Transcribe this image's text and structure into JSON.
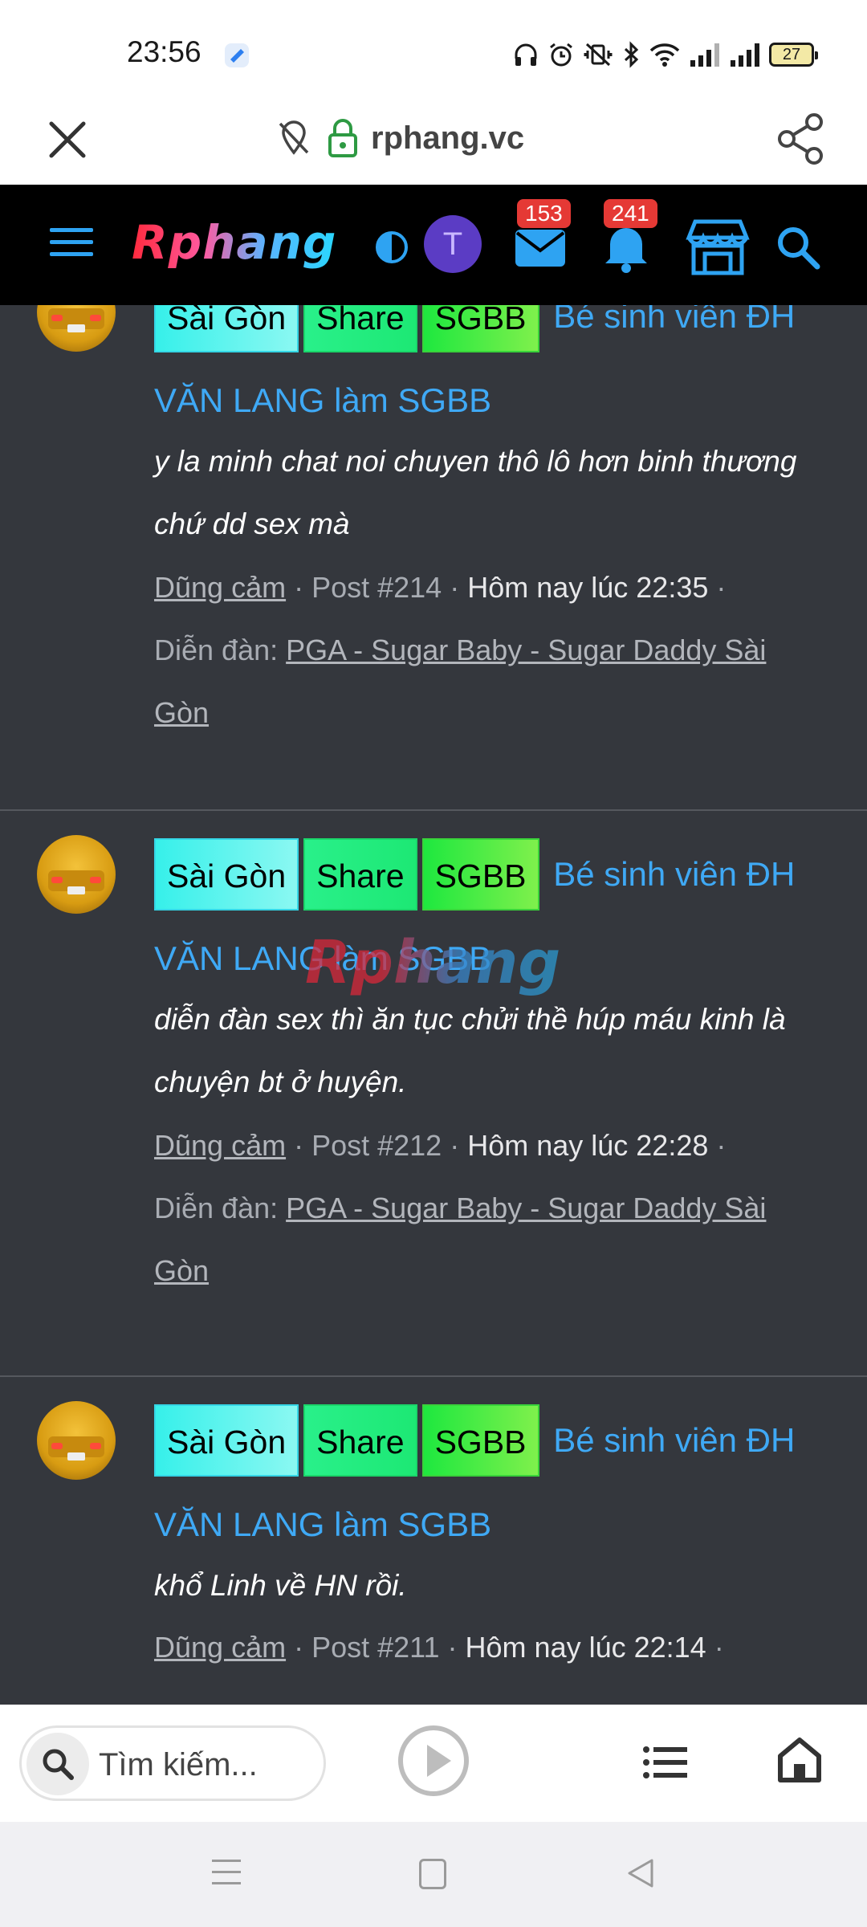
{
  "status_bar": {
    "time": "23:56",
    "battery": "27",
    "icons": [
      "headphones-icon",
      "alarm-icon",
      "vibrate-off-icon",
      "bluetooth-icon",
      "wifi-icon",
      "signal-icon-1",
      "signal-icon-2",
      "battery-icon"
    ]
  },
  "browser": {
    "url": "rphang.vc",
    "close_icon": "close-icon",
    "share_icon": "share-icon"
  },
  "site_header": {
    "logo": "Rphang",
    "avatar_letter": "T",
    "messages_count": "153",
    "alerts_count": "241",
    "colors": {
      "badge": "#e53935",
      "avatar": "#5b3cc4",
      "link": "#3fa9f5"
    }
  },
  "posts": [
    {
      "tags": [
        "Sài Gòn",
        "Share",
        "SGBB"
      ],
      "title_line1": "Bé sinh viên ĐH",
      "title_line2": "VĂN LANG làm SGBB",
      "snippet_line1": "y la minh chat noi chuyen thô lô hơn binh thương",
      "snippet_line2": "chứ dd sex mà",
      "author": "Dũng cảm",
      "post_no": "Post #214",
      "time": "Hôm nay lúc 22:35",
      "forum_label": "Diễn đàn:",
      "forum_line1": "PGA - Sugar Baby - Sugar Daddy Sài",
      "forum_line2": "Gòn"
    },
    {
      "tags": [
        "Sài Gòn",
        "Share",
        "SGBB"
      ],
      "title_line1": "Bé sinh viên ĐH",
      "title_line2": "VĂN LANG làm SGBB",
      "snippet_line1": "diễn đàn sex thì ăn tục chửi thề húp máu kinh là",
      "snippet_line2": "chuyện bt ở huyện.",
      "author": "Dũng cảm",
      "post_no": "Post #212",
      "time": "Hôm nay lúc 22:28",
      "forum_label": "Diễn đàn:",
      "forum_line1": "PGA - Sugar Baby - Sugar Daddy Sài",
      "forum_line2": "Gòn"
    },
    {
      "tags": [
        "Sài Gòn",
        "Share",
        "SGBB"
      ],
      "title_line1": "Bé sinh viên ĐH",
      "title_line2": "VĂN LANG làm SGBB",
      "snippet_line1": "khổ Linh về HN rồi.",
      "author": "Dũng cảm",
      "post_no": "Post #211",
      "time": "Hôm nay lúc 22:14"
    }
  ],
  "watermark": "Rphang",
  "bottom_toolbar": {
    "search_placeholder": "Tìm kiếm..."
  }
}
